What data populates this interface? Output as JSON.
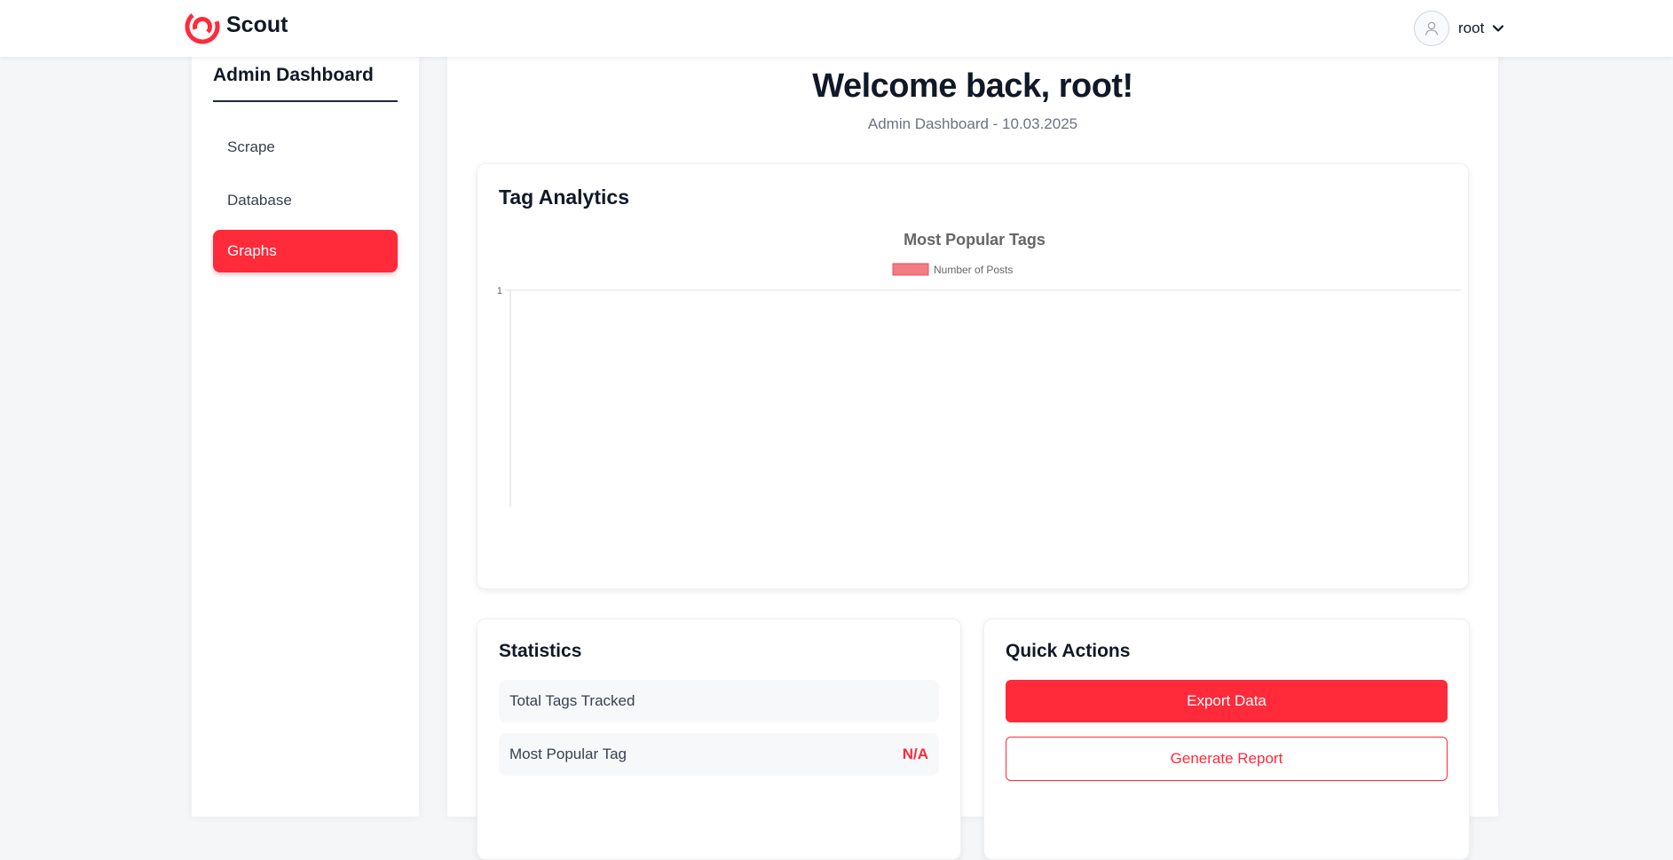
{
  "app": {
    "brand": "Scout",
    "user": {
      "name": "root"
    }
  },
  "colors": {
    "accent": "#ff2a3a",
    "chart_series_fill": "#f27b84",
    "chart_series_border": "#e8505b"
  },
  "sidebar": {
    "title": "Admin Dashboard",
    "items": [
      {
        "label": "Scrape",
        "active": false
      },
      {
        "label": "Database",
        "active": false
      },
      {
        "label": "Graphs",
        "active": true
      }
    ]
  },
  "header": {
    "welcome": "Welcome back, root!",
    "subtitle": "Admin Dashboard - 10.03.2025"
  },
  "tag_analytics": {
    "title": "Tag Analytics"
  },
  "chart_data": {
    "type": "bar",
    "title": "Most Popular Tags",
    "categories": [],
    "series": [
      {
        "name": "Number of Posts",
        "values": []
      }
    ],
    "ylim": [
      0,
      1
    ],
    "yticks": [
      "0",
      "1"
    ],
    "legend": "top-center",
    "grid": true
  },
  "statistics": {
    "title": "Statistics",
    "rows": [
      {
        "label": "Total Tags Tracked",
        "value": ""
      },
      {
        "label": "Most Popular Tag",
        "value": "N/A"
      }
    ]
  },
  "quick_actions": {
    "title": "Quick Actions",
    "export_label": "Export Data",
    "report_label": "Generate Report"
  }
}
